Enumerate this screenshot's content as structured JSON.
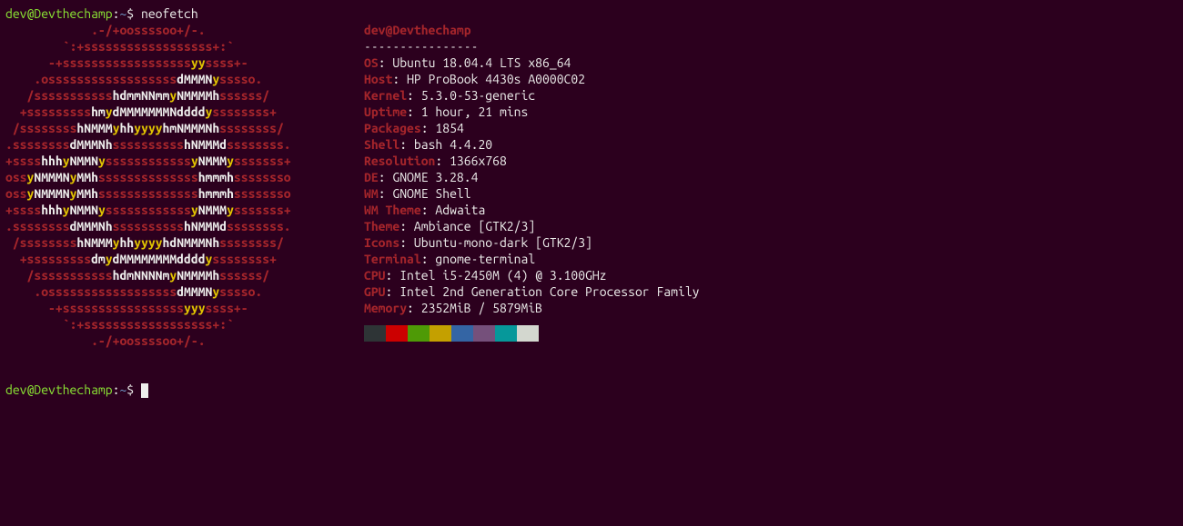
{
  "prompt": {
    "user": "dev@Devthechamp",
    "sep": ":",
    "path": "~",
    "sigil": "$",
    "command": "neofetch"
  },
  "header": {
    "title": "dev@Devthechamp",
    "sep": "----------------"
  },
  "logo_lines": [
    "            .-/+oossssoo+/-.",
    "        `:+ssssssssssssssssss+:`",
    "      -+ssssssssssssssssssyyssss+-",
    "    .ossssssssssssssssssdMMMNysssso.",
    "   /ssssssssssshdmmNNmmyNMMMMhssssss/",
    "  +ssssssssshmydMMMMMMMNddddyssssssss+",
    " /sssssssshNMMMyhhyyyyhmNMMMNhssssssss/",
    ".ssssssssdMMMNhsssssssssshNMMMdssssssss.",
    "+sssshhhyNMMNyssssssssssssyNMMMysssssss+",
    "ossyNMMMNyMMhsssssssssssssshmmmhssssssso",
    "ossyNMMMNyMMhsssssssssssssshmmmhssssssso",
    "+sssshhhyNMMNyssssssssssssyNMMMysssssss+",
    ".ssssssssdMMMNhsssssssssshNMMMdssssssss.",
    " /sssssssshNMMMyhhyyyyhdNMMMNhssssssss/",
    "  +sssssssssdmydMMMMMMMMddddyssssssss+",
    "   /ssssssssssshdmNNNNmyNMMMMhssssss/",
    "    .ossssssssssssssssssdMMMNysssso.",
    "      -+sssssssssssssssssyyyssss+-",
    "        `:+ssssssssssssssssss+:`",
    "            .-/+oossssoo+/-."
  ],
  "info": [
    {
      "k": "OS",
      "v": "Ubuntu 18.04.4 LTS x86_64"
    },
    {
      "k": "Host",
      "v": "HP ProBook 4430s A0000C02"
    },
    {
      "k": "Kernel",
      "v": "5.3.0-53-generic"
    },
    {
      "k": "Uptime",
      "v": "1 hour, 21 mins"
    },
    {
      "k": "Packages",
      "v": "1854"
    },
    {
      "k": "Shell",
      "v": "bash 4.4.20"
    },
    {
      "k": "Resolution",
      "v": "1366x768"
    },
    {
      "k": "DE",
      "v": "GNOME 3.28.4"
    },
    {
      "k": "WM",
      "v": "GNOME Shell"
    },
    {
      "k": "WM Theme",
      "v": "Adwaita"
    },
    {
      "k": "Theme",
      "v": "Ambiance [GTK2/3]"
    },
    {
      "k": "Icons",
      "v": "Ubuntu-mono-dark [GTK2/3]"
    },
    {
      "k": "Terminal",
      "v": "gnome-terminal"
    },
    {
      "k": "CPU",
      "v": "Intel i5-2450M (4) @ 3.100GHz"
    },
    {
      "k": "GPU",
      "v": "Intel 2nd Generation Core Processor Family"
    },
    {
      "k": "Memory",
      "v": "2352MiB / 5879MiB"
    }
  ],
  "swatches": [
    "#2e3436",
    "#cc0000",
    "#4e9a06",
    "#c4a000",
    "#3465a4",
    "#75507b",
    "#06989a",
    "#d3d7cf"
  ]
}
